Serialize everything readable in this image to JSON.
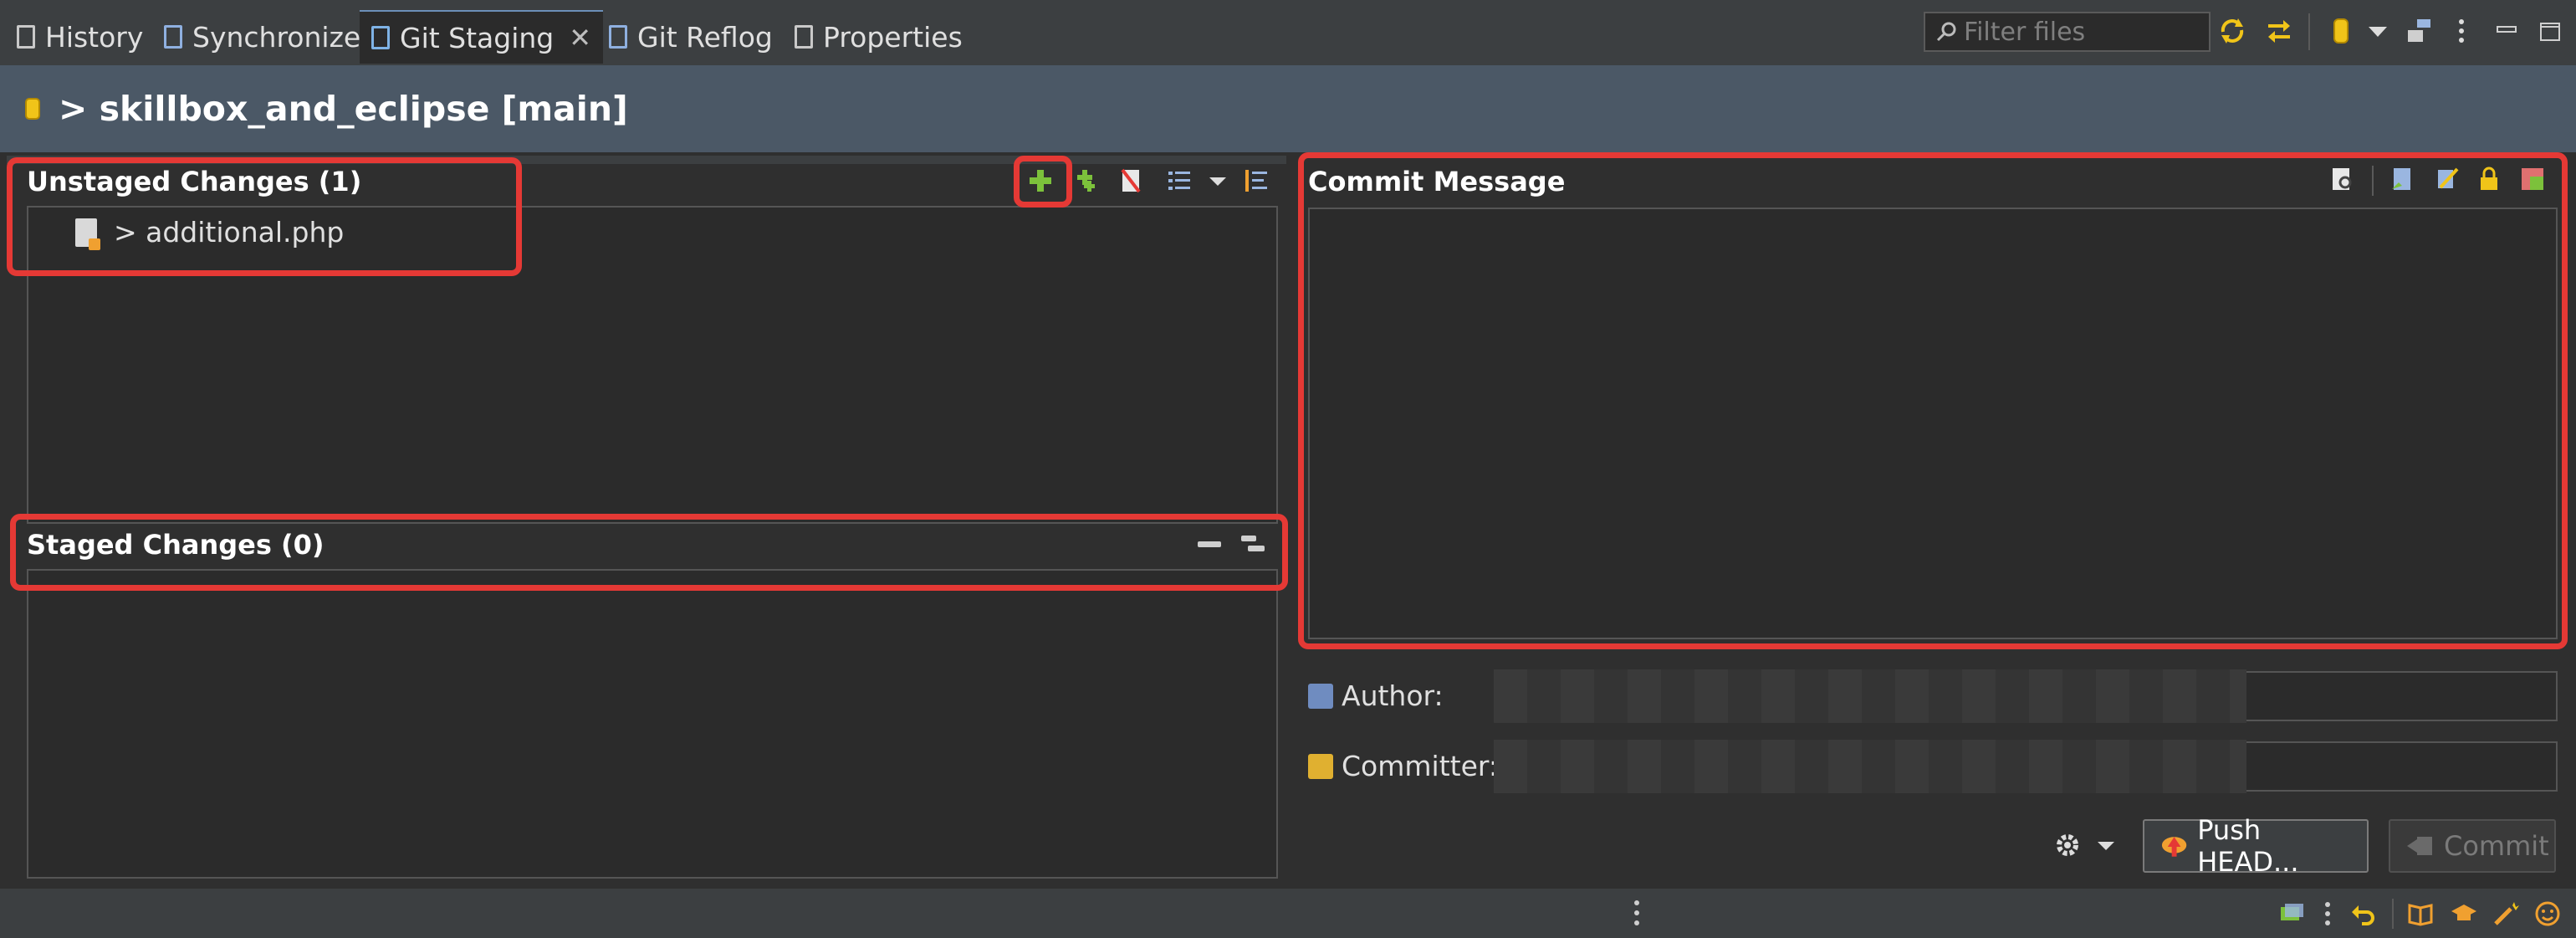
{
  "tabs": [
    {
      "label": "History",
      "icon": "history-icon"
    },
    {
      "label": "Synchronize",
      "icon": "synchronize-icon"
    },
    {
      "label": "Git Staging",
      "icon": "git-staging-icon",
      "active": true,
      "close": "✕"
    },
    {
      "label": "Git Reflog",
      "icon": "git-reflog-icon"
    },
    {
      "label": "Properties",
      "icon": "properties-icon"
    }
  ],
  "filter": {
    "placeholder": "Filter files"
  },
  "repo": {
    "title": "> skillbox_and_eclipse [main]"
  },
  "unstaged": {
    "title": "Unstaged Changes (1)",
    "items": [
      {
        "label": "> additional.php"
      }
    ]
  },
  "staged": {
    "title": "Staged Changes (0)"
  },
  "commit": {
    "title": "Commit Message",
    "author_label": "Author:",
    "committer_label": "Committer:",
    "push_label": "Push HEAD...",
    "commit_label": "Commit"
  },
  "colors": {
    "highlight": "#e53935",
    "panel": "#2b2b2b",
    "header": "#4b5866",
    "add_icon": "#7cc13b"
  }
}
